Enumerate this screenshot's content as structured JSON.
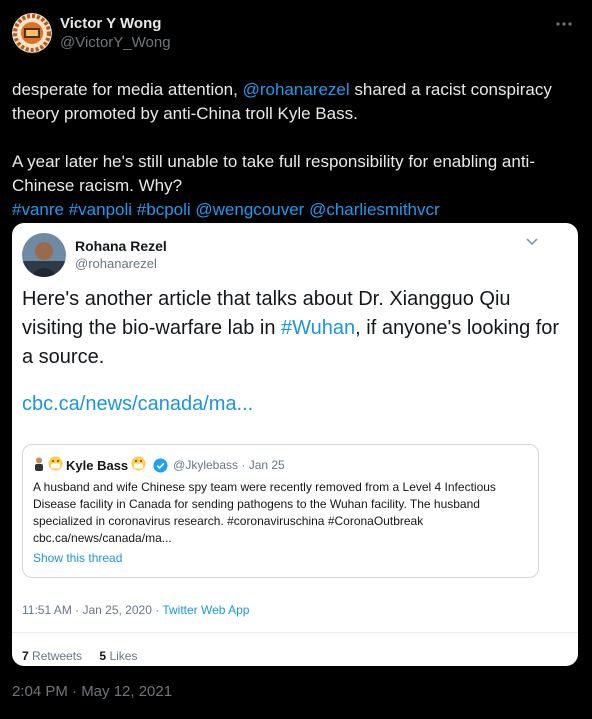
{
  "post": {
    "author_name": "Victor Y Wong",
    "author_handle": "@VictorY_Wong",
    "text_line1_prefix": "desperate for media attention, ",
    "mention1": "@rohanarezel",
    "text_line1_suffix": " shared a racist conspiracy theory promoted by anti-China troll Kyle Bass.",
    "text_para2": "A year later he's still unable to take full responsibility for enabling anti-Chinese racism. Why?",
    "tags": [
      "#vanre",
      "#vanpoli",
      "#bcpoli",
      "@wengcouver",
      "@charliesmithvcr"
    ],
    "timestamp": "2:04 PM · May 12, 2021"
  },
  "embedded": {
    "author_name": "Rohana Rezel",
    "author_handle": "@rohanarezel",
    "text_before": "Here's another article that talks about Dr. Xiangguo Qiu visiting the bio-warfare lab in ",
    "hashtag": "#Wuhan",
    "text_after": ", if anyone's looking for a source.",
    "link": "cbc.ca/news/canada/ma...",
    "meta_time": "11:51 AM · Jan 25, 2020 · ",
    "meta_app": "Twitter Web App",
    "retweets_count": "7",
    "retweets_label": "Retweets",
    "likes_count": "5",
    "likes_label": "Likes",
    "quote": {
      "name": "Kyle Bass",
      "handle_date": "@Jkylebass · Jan 25",
      "text": "A husband and wife Chinese spy team were recently removed from a Level 4 Infectious Disease facility in Canada for sending pathogens to the Wuhan facility. The husband specialized in coronavirus research. #coronaviruschina #CoronaOutbreak  cbc.ca/news/canada/ma...",
      "show_thread": "Show this thread"
    }
  },
  "colors": {
    "accent": "#1d9bf0",
    "background": "#000000",
    "text": "#e7e9ea",
    "muted": "#71767b"
  },
  "icons": {
    "more": "more-dots-icon",
    "chevron": "chevron-down-icon",
    "verified": "verified-badge-icon"
  }
}
